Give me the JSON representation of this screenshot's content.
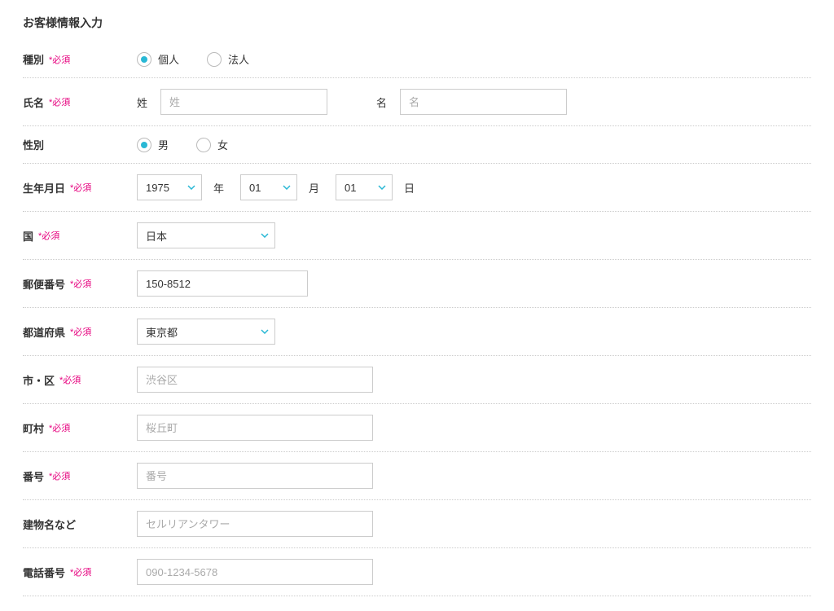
{
  "title": "お客様情報入力",
  "required_mark": "*必須",
  "labels": {
    "type": "種別",
    "name": "氏名",
    "sex": "性別",
    "birth": "生年月日",
    "country": "国",
    "postal": "郵便番号",
    "pref": "都道府県",
    "city": "市・区",
    "town": "町村",
    "number": "番号",
    "building": "建物名など",
    "phone": "電話番号"
  },
  "type_options": {
    "individual": "個人",
    "corporate": "法人"
  },
  "name": {
    "last_label": "姓",
    "first_label": "名",
    "last_ph": "姓",
    "first_ph": "名"
  },
  "sex_options": {
    "male": "男",
    "female": "女"
  },
  "birth": {
    "year": "1975",
    "year_unit": "年",
    "month": "01",
    "month_unit": "月",
    "day": "01",
    "day_unit": "日"
  },
  "country_value": "日本",
  "postal_value": "150-8512",
  "pref_value": "東京都",
  "city_ph": "渋谷区",
  "town_ph": "桜丘町",
  "number_ph": "番号",
  "building_ph": "セルリアンタワー",
  "phone_ph": "090-1234-5678",
  "colors": {
    "accent": "#29b8d5",
    "required": "#e6007e"
  }
}
